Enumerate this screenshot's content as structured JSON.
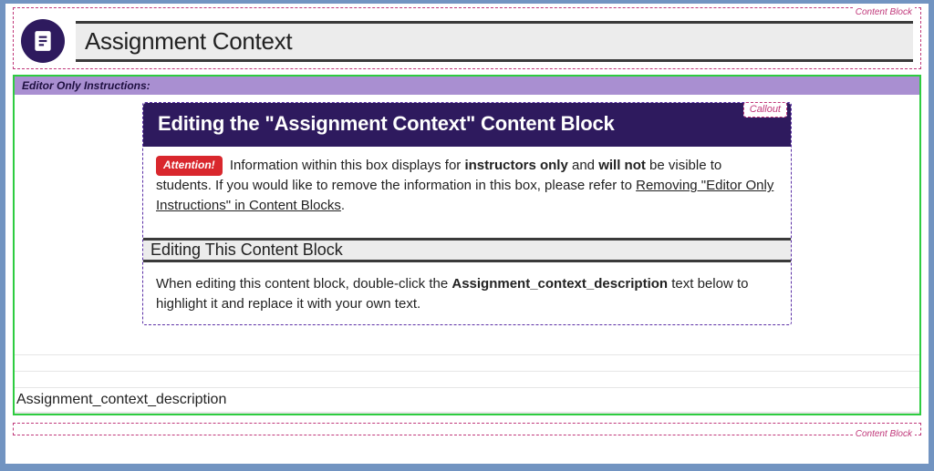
{
  "labels": {
    "content_block": "Content Block",
    "callout": "Callout"
  },
  "heading": {
    "title": "Assignment Context",
    "icon": "document-icon"
  },
  "editor_instructions": {
    "bar_label": "Editor Only Instructions:",
    "callout": {
      "title": "Editing the \"Assignment Context\" Content Block",
      "attention_label": "Attention!",
      "pre_text": "Information within this box displays for ",
      "bold1": "instructors only",
      "mid_text": " and ",
      "bold2": "will not",
      "post_text": " be visible to students. If you would like to remove the information in this box, please refer to ",
      "link_text": "Removing \"Editor Only Instructions\" in Content Blocks",
      "period": ".",
      "sub_heading": "Editing This Content Block",
      "sub_body_pre": "When editing this content block, double-click the ",
      "sub_body_bold": "Assignment_context_description",
      "sub_body_post": " text below to highlight it and replace it with your own text."
    }
  },
  "placeholder": {
    "text": "Assignment_context_description"
  }
}
